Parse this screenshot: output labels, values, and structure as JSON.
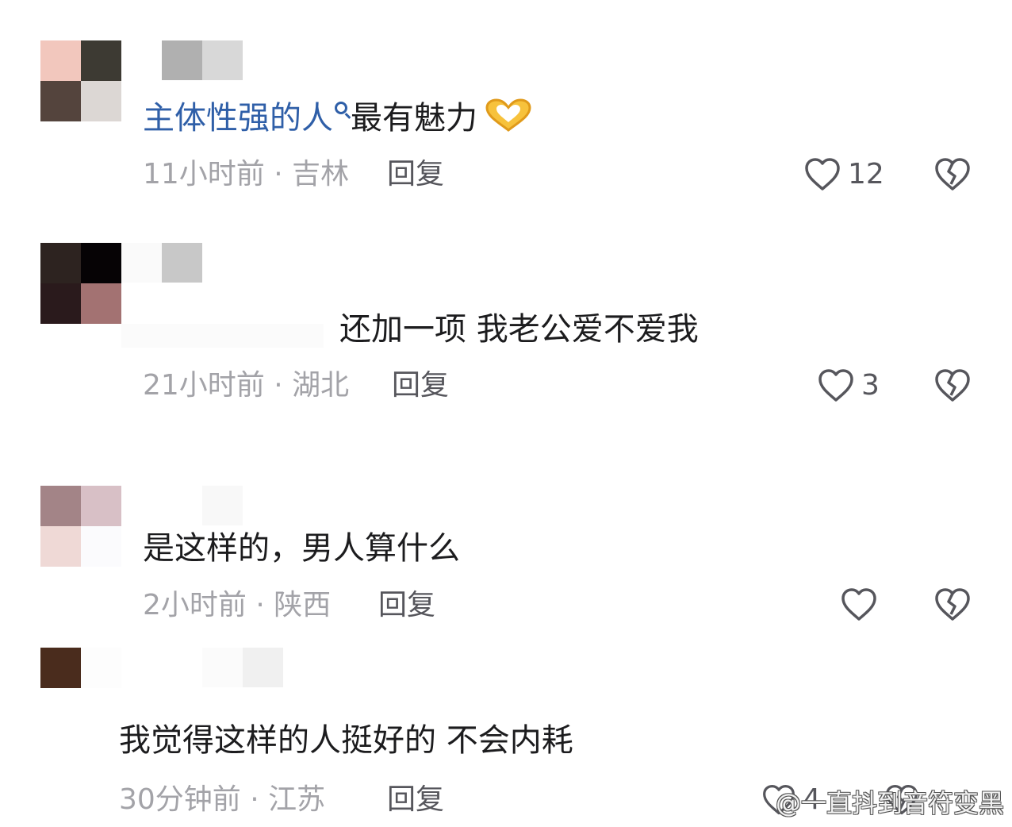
{
  "comments": [
    {
      "topic": "主体性强的人",
      "text": "最有魅力",
      "emoji": "heart-hands-emoji",
      "meta": "11小时前 · 吉林",
      "reply": "回复",
      "likes": "12"
    },
    {
      "text": "还加一项 我老公爱不爱我",
      "meta": "21小时前 · 湖北",
      "reply": "回复",
      "likes": "3"
    },
    {
      "text": "是这样的，男人算什么",
      "meta": "2小时前 · 陕西",
      "reply": "回复",
      "likes": ""
    },
    {
      "text": "我觉得这样的人挺好的 不会内耗",
      "meta": "30分钟前 · 江苏",
      "reply": "回复",
      "likes": "4"
    }
  ],
  "watermark": "@一直抖到音符变黑",
  "colors": {
    "topic_link": "#2f5fa8",
    "meta_text": "#a3a3a8",
    "action_text": "#56565c"
  }
}
